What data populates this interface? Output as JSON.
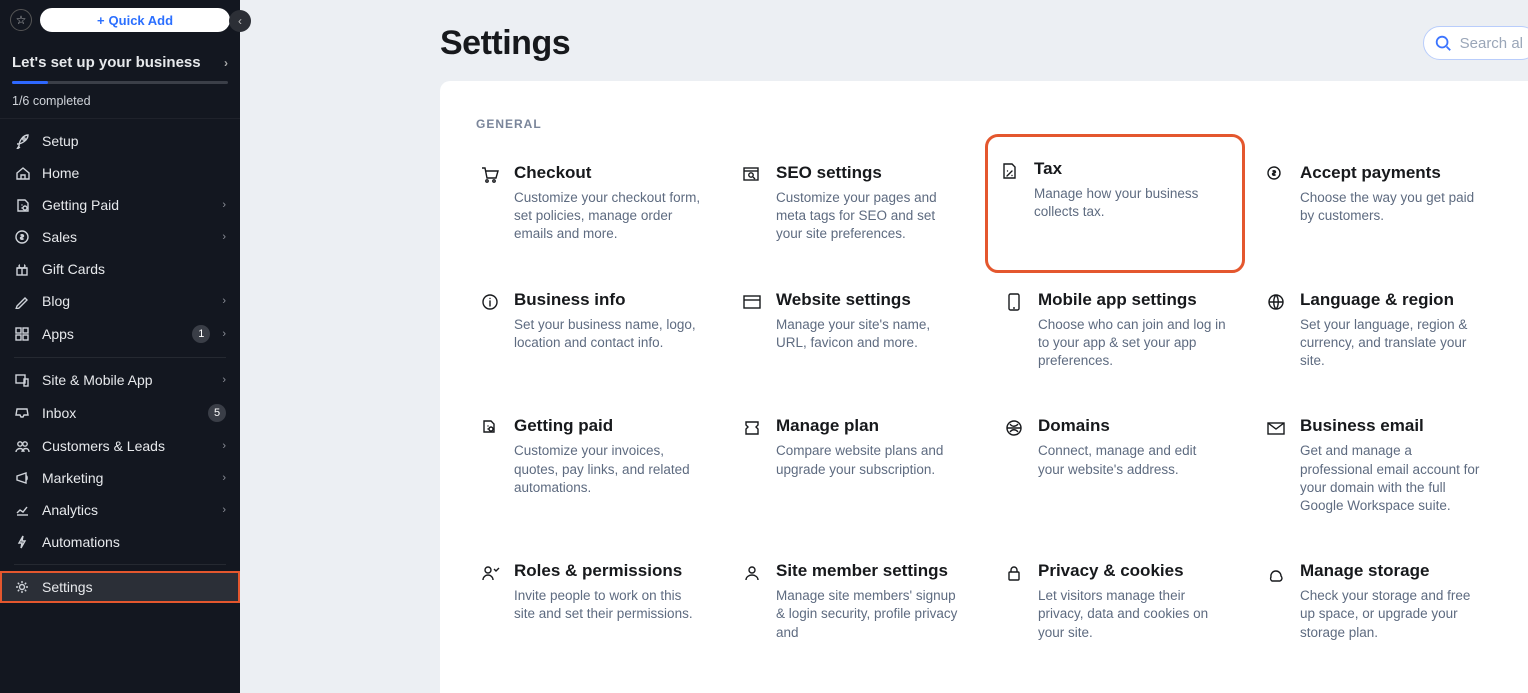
{
  "sidebar": {
    "quick_add_label": "Quick Add",
    "setup_heading": "Let's set up your business",
    "progress_label": "1/6 completed",
    "items": [
      {
        "icon": "rocket",
        "label": "Setup",
        "chev": false,
        "badge": null
      },
      {
        "icon": "home",
        "label": "Home",
        "chev": false,
        "badge": null
      },
      {
        "icon": "paid",
        "label": "Getting Paid",
        "chev": true,
        "badge": null
      },
      {
        "icon": "dollar",
        "label": "Sales",
        "chev": true,
        "badge": null
      },
      {
        "icon": "gift",
        "label": "Gift Cards",
        "chev": false,
        "badge": null
      },
      {
        "icon": "pen",
        "label": "Blog",
        "chev": true,
        "badge": null
      },
      {
        "icon": "apps",
        "label": "Apps",
        "chev": true,
        "badge": "1"
      }
    ],
    "items2": [
      {
        "icon": "site",
        "label": "Site & Mobile App",
        "chev": true,
        "badge": null
      },
      {
        "icon": "inbox",
        "label": "Inbox",
        "chev": false,
        "badge": "5"
      },
      {
        "icon": "customers",
        "label": "Customers & Leads",
        "chev": true,
        "badge": null
      },
      {
        "icon": "marketing",
        "label": "Marketing",
        "chev": true,
        "badge": null
      },
      {
        "icon": "analytics",
        "label": "Analytics",
        "chev": true,
        "badge": null
      },
      {
        "icon": "automations",
        "label": "Automations",
        "chev": false,
        "badge": null
      }
    ],
    "settings_label": "Settings"
  },
  "page": {
    "title": "Settings",
    "search_placeholder": "Search al",
    "section_label": "GENERAL",
    "cards": [
      {
        "icon": "cart",
        "title": "Checkout",
        "desc": "Customize your checkout form, set policies, manage order emails and more."
      },
      {
        "icon": "seo",
        "title": "SEO settings",
        "desc": "Customize your pages and meta tags for SEO and set your site preferences."
      },
      {
        "icon": "tax",
        "title": "Tax",
        "desc": "Manage how your business collects tax.",
        "highlight": true
      },
      {
        "icon": "dollar",
        "title": "Accept payments",
        "desc": "Choose the way you get paid by customers."
      },
      {
        "icon": "info",
        "title": "Business info",
        "desc": "Set your business name, logo, location and contact info."
      },
      {
        "icon": "browser",
        "title": "Website settings",
        "desc": "Manage your site's name, URL, favicon and more."
      },
      {
        "icon": "mobile",
        "title": "Mobile app settings",
        "desc": "Choose who can join and log in to your app & set your app preferences."
      },
      {
        "icon": "globe",
        "title": "Language & region",
        "desc": "Set your language, region & currency, and translate your site."
      },
      {
        "icon": "paid",
        "title": "Getting paid",
        "desc": "Customize your invoices, quotes, pay links, and related automations."
      },
      {
        "icon": "plan",
        "title": "Manage plan",
        "desc": "Compare website plans and upgrade your subscription."
      },
      {
        "icon": "domain",
        "title": "Domains",
        "desc": "Connect, manage and edit your website's address."
      },
      {
        "icon": "mail",
        "title": "Business email",
        "desc": "Get and manage a professional email account for your domain with the full Google Workspace suite."
      },
      {
        "icon": "roles",
        "title": "Roles & permissions",
        "desc": "Invite people to work on this site and set their permissions."
      },
      {
        "icon": "member",
        "title": "Site member settings",
        "desc": "Manage site members' signup & login security, profile privacy and"
      },
      {
        "icon": "privacy",
        "title": "Privacy & cookies",
        "desc": "Let visitors manage their privacy, data and cookies on your site."
      },
      {
        "icon": "storage",
        "title": "Manage storage",
        "desc": "Check your storage and free up space, or upgrade your storage plan."
      }
    ]
  }
}
